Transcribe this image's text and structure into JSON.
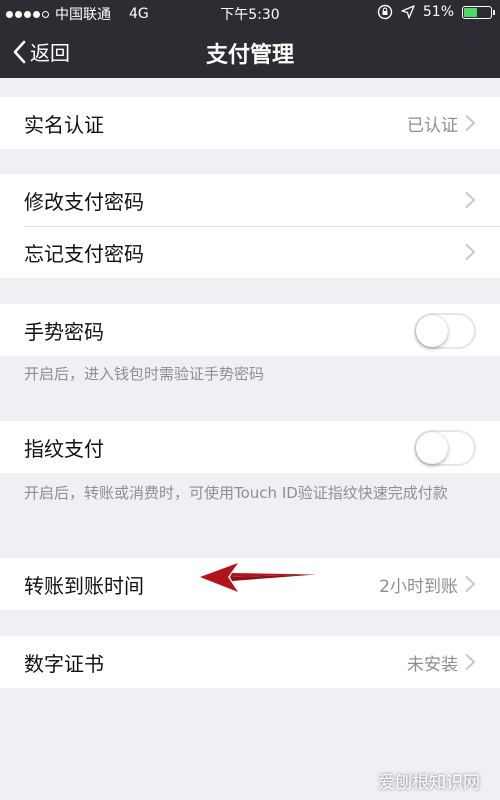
{
  "status": {
    "carrier": "中国联通",
    "network": "4G",
    "time": "下午5:30",
    "battery": "51%",
    "battery_fill": 0.51
  },
  "nav": {
    "back_label": "返回",
    "title": "支付管理"
  },
  "settings": {
    "realname": {
      "label": "实名认证",
      "value": "已认证"
    },
    "change_password": {
      "label": "修改支付密码"
    },
    "forgot_password": {
      "label": "忘记支付密码"
    },
    "gesture": {
      "label": "手势密码",
      "enabled": false,
      "note": "开启后，进入钱包时需验证手势密码"
    },
    "fingerprint": {
      "label": "指纹支付",
      "enabled": false,
      "note": "开启后，转账或消费时，可使用Touch ID验证指纹快速完成付款"
    },
    "transfer_time": {
      "label": "转账到账时间",
      "value": "2小时到账"
    },
    "certificate": {
      "label": "数字证书",
      "value": "未安装"
    }
  },
  "watermark": "爱刨根知识网",
  "colors": {
    "nav_bg": "#2e2c33",
    "page_bg": "#efeff4",
    "arrow": "#b3141c",
    "battery_green": "#4cd964"
  }
}
